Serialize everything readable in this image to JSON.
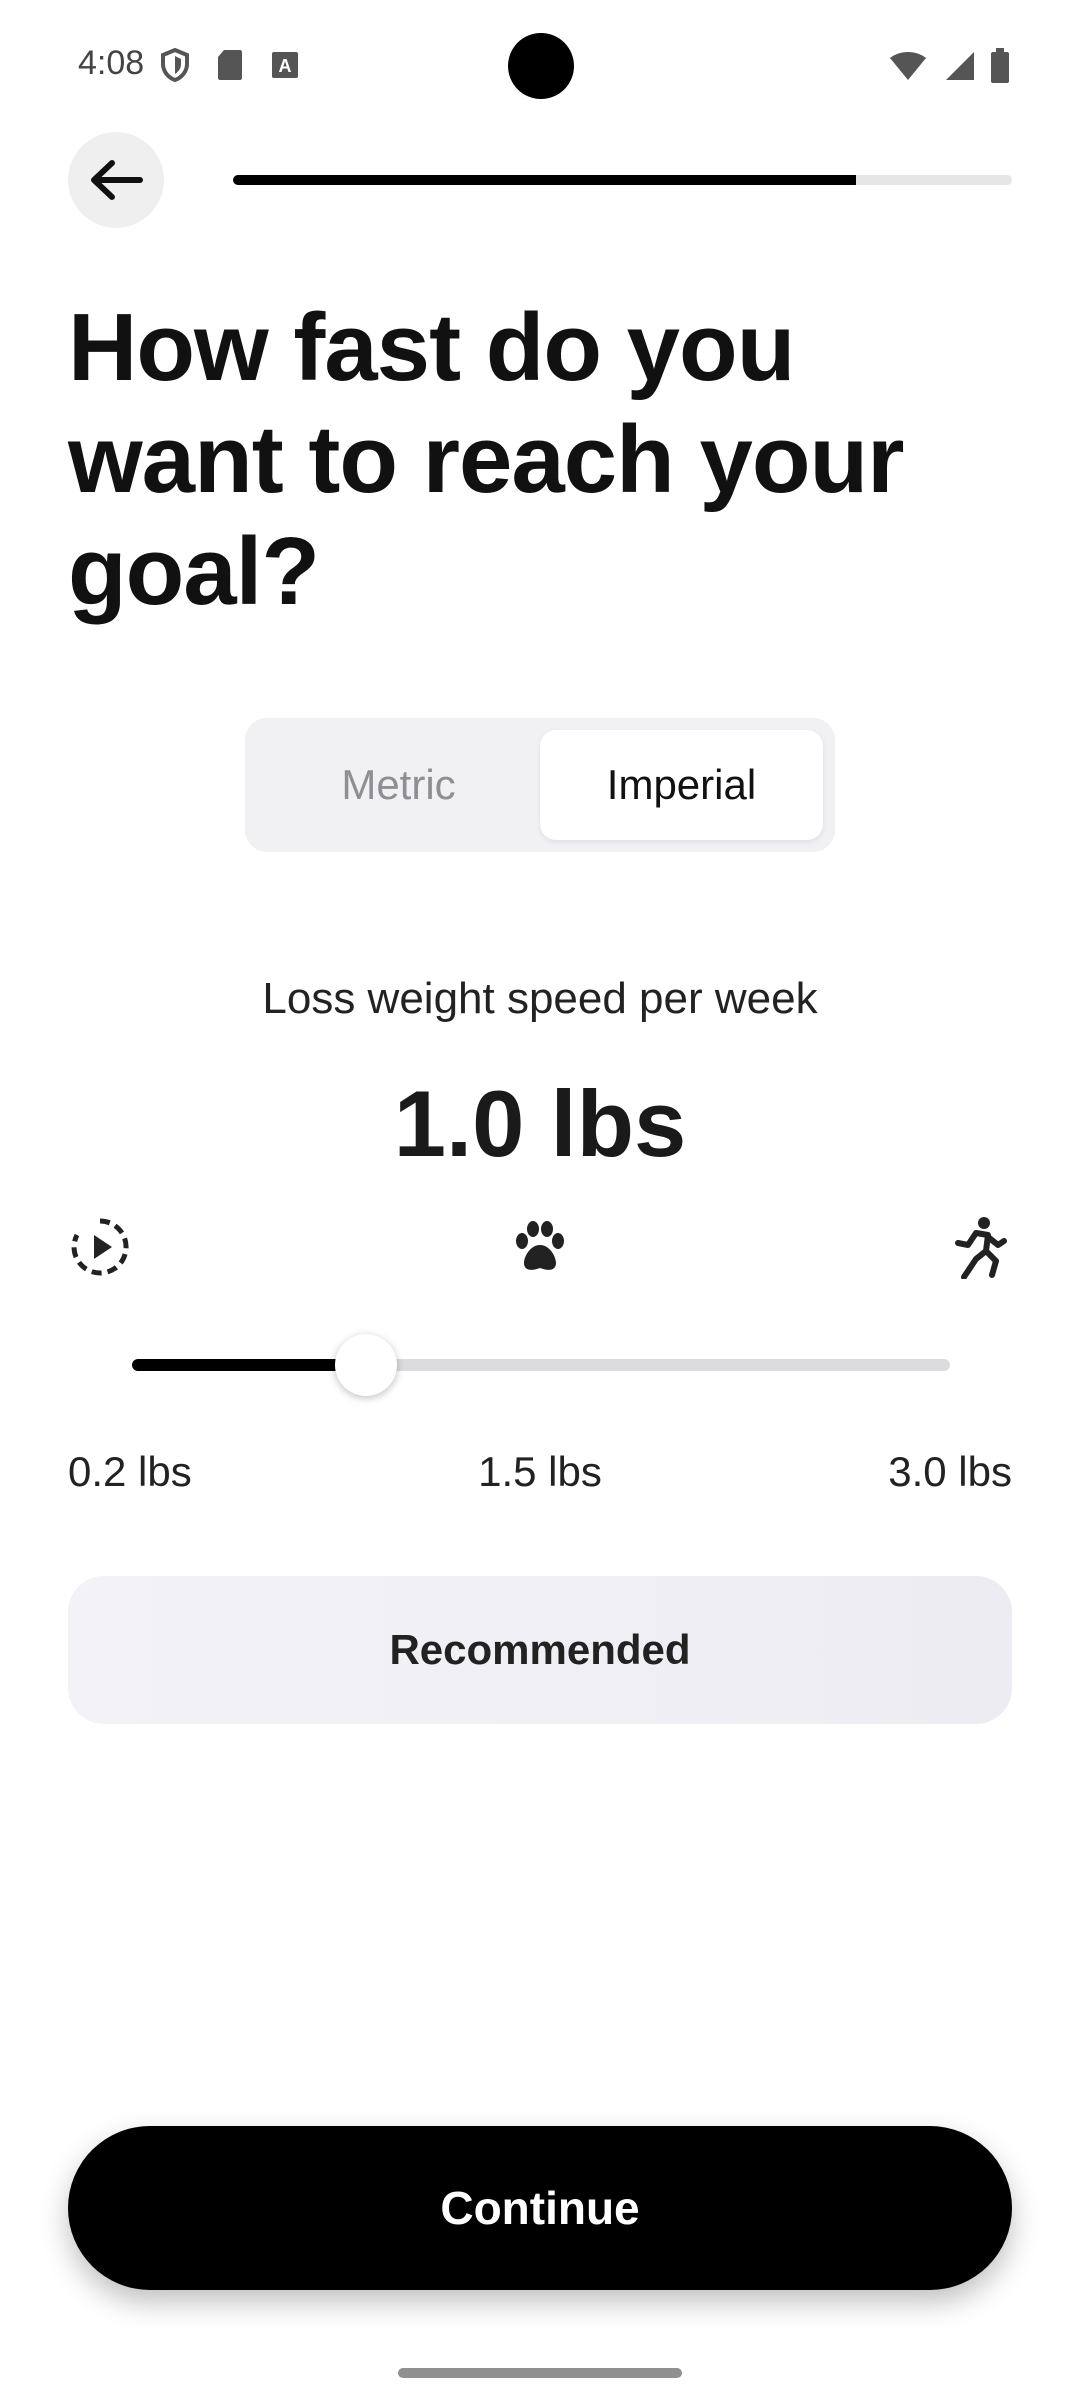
{
  "status_bar": {
    "time": "4:08",
    "left_icons": [
      "shield-icon",
      "sd-card-icon",
      "font-a-icon"
    ],
    "right_icons": [
      "wifi-icon",
      "signal-icon",
      "battery-icon"
    ]
  },
  "header": {
    "back_icon": "arrow-left-icon",
    "progress_fraction": 0.8
  },
  "title": "How fast do you want to reach your goal?",
  "unit_toggle": {
    "options": [
      "Metric",
      "Imperial"
    ],
    "selected": "Imperial"
  },
  "speed": {
    "label": "Loss weight speed per week",
    "value": "1.0 lbs",
    "numeric_value": 1.0,
    "min": 0.2,
    "max": 3.0,
    "icons": [
      "slow-timer-icon",
      "paw-icon",
      "running-icon"
    ],
    "ticks": [
      "0.2 lbs",
      "1.5 lbs",
      "3.0 lbs"
    ]
  },
  "recommendation": "Recommended",
  "continue_label": "Continue",
  "colors": {
    "accent": "#000000",
    "track": "#dcdcdf",
    "badge_bg": "#f1f1f4"
  }
}
